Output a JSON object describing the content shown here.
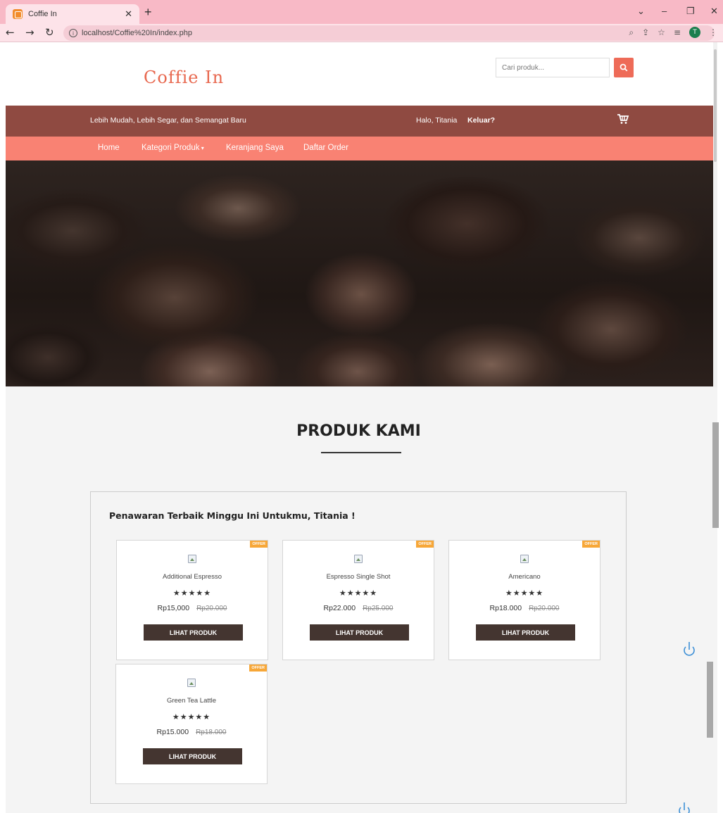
{
  "browser": {
    "tab_title": "Coffie In",
    "url": "localhost/Coffie%20In/index.php",
    "profile_initial": "T"
  },
  "header": {
    "logo": "Coffie In",
    "search_placeholder": "Cari produk..."
  },
  "topbar": {
    "tagline": "Lebih Mudah, Lebih Segar, dan Semangat Baru",
    "greeting": "Halo, Titania",
    "logout": "Keluar?"
  },
  "nav": {
    "home": "Home",
    "categories": "Kategori Produk",
    "cart": "Keranjang Saya",
    "orders": "Daftar Order"
  },
  "section": {
    "title": "PRODUK KAMI",
    "offer_heading": "Penawaran Terbaik Minggu Ini Untukmu, Titania !"
  },
  "products": [
    {
      "name": "Additional Espresso",
      "price": "Rp15,000",
      "old_price": "Rp20.000",
      "rating": 5,
      "stars": "★★★★★",
      "badge": "OFFER",
      "button": "LIHAT PRODUK"
    },
    {
      "name": "Espresso Single Shot",
      "price": "Rp22.000",
      "old_price": "Rp25.000",
      "rating": 5,
      "stars": "★★★★★",
      "badge": "OFFER",
      "button": "LIHAT PRODUK"
    },
    {
      "name": "Americano",
      "price": "Rp18.000",
      "old_price": "Rp20.000",
      "rating": 5,
      "stars": "★★★★★",
      "badge": "OFFER",
      "button": "LIHAT PRODUK"
    },
    {
      "name": "Green Tea Lattle",
      "price": "Rp15.000",
      "old_price": "Rp18.000",
      "rating": 5,
      "stars": "★★★★★",
      "badge": "OFFER",
      "button": "LIHAT PRODUK"
    }
  ],
  "colors": {
    "tabbar": "#f8b9c6",
    "logo": "#e8684f",
    "topbar": "#8f4a41",
    "navmenu": "#f98273",
    "button": "#443530",
    "badge": "#f7a738"
  }
}
